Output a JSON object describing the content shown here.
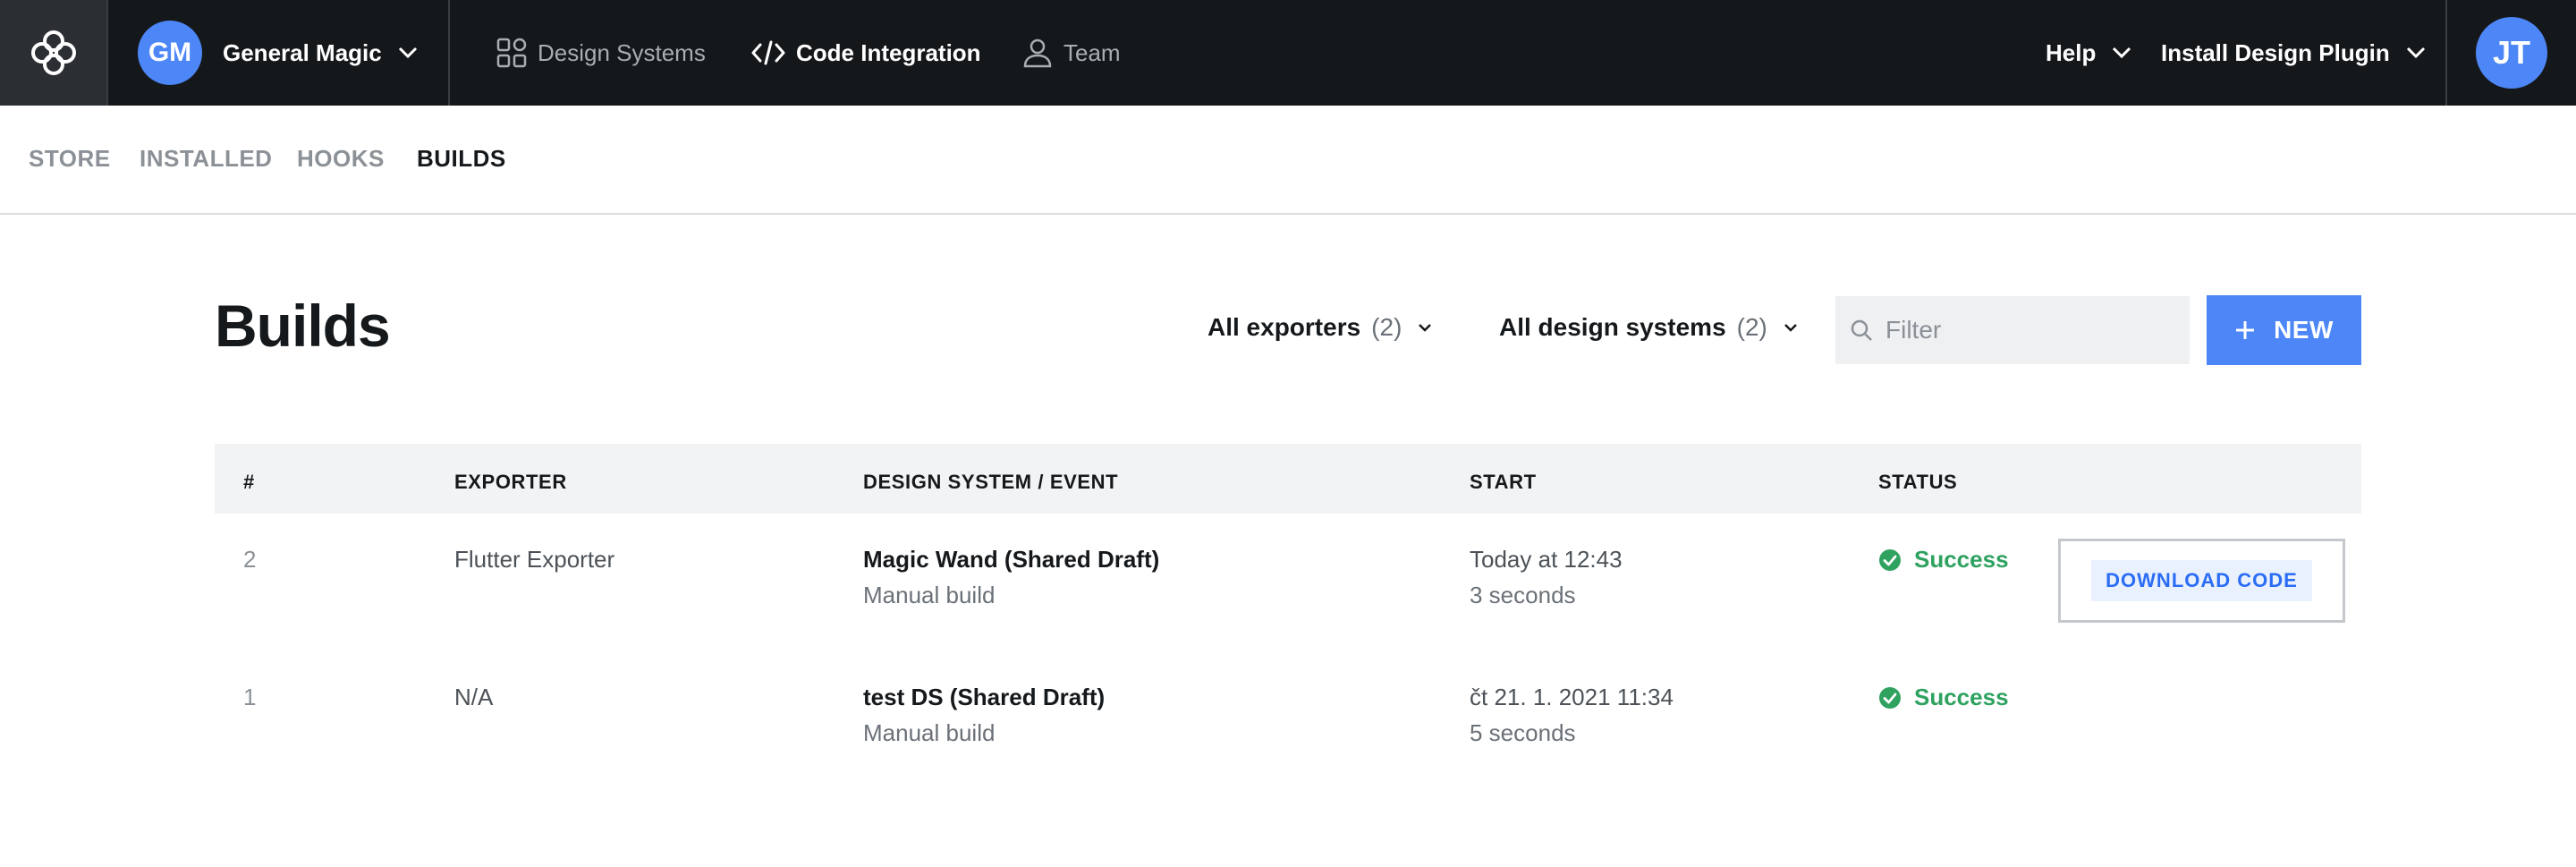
{
  "topbar": {
    "logo_icon": "flower-logo-icon",
    "workspace": {
      "initials": "GM",
      "name": "General Magic",
      "avatar_color": "#4d86f6"
    },
    "nav": [
      {
        "id": "design-systems",
        "label": "Design Systems",
        "icon": "grid-shapes-icon",
        "active": false
      },
      {
        "id": "code-integration",
        "label": "Code Integration",
        "icon": "code-brackets-icon",
        "active": true
      },
      {
        "id": "team",
        "label": "Team",
        "icon": "person-icon",
        "active": false
      }
    ],
    "help_label": "Help",
    "plugin_label": "Install Design Plugin",
    "user": {
      "initials": "JT",
      "avatar_color": "#4d86f6"
    }
  },
  "subtabs": [
    {
      "label": "STORE",
      "active": false
    },
    {
      "label": "INSTALLED",
      "active": false
    },
    {
      "label": "HOOKS",
      "active": false
    },
    {
      "label": "BUILDS",
      "active": true
    }
  ],
  "page": {
    "title": "Builds",
    "filters": [
      {
        "label": "All exporters",
        "count": "(2)"
      },
      {
        "label": "All design systems",
        "count": "(2)"
      }
    ],
    "search": {
      "placeholder": "Filter",
      "value": ""
    },
    "new_button": "NEW"
  },
  "table": {
    "columns": [
      "#",
      "EXPORTER",
      "DESIGN SYSTEM / EVENT",
      "START",
      "STATUS"
    ],
    "rows": [
      {
        "number": "2",
        "exporter": "Flutter Exporter",
        "design_system": "Magic Wand (Shared Draft)",
        "event": "Manual build",
        "start": "Today at 12:43",
        "duration": "3 seconds",
        "status": "Success",
        "action": "DOWNLOAD CODE"
      },
      {
        "number": "1",
        "exporter": "N/A",
        "design_system": "test DS (Shared Draft)",
        "event": "Manual build",
        "start": "čt 21. 1. 2021 11:34",
        "duration": "5 seconds",
        "status": "Success"
      }
    ]
  },
  "colors": {
    "topbar_bg": "#15181b",
    "accent": "#4d86f6",
    "success": "#2fa260",
    "header_bg": "#f2f3f5"
  }
}
